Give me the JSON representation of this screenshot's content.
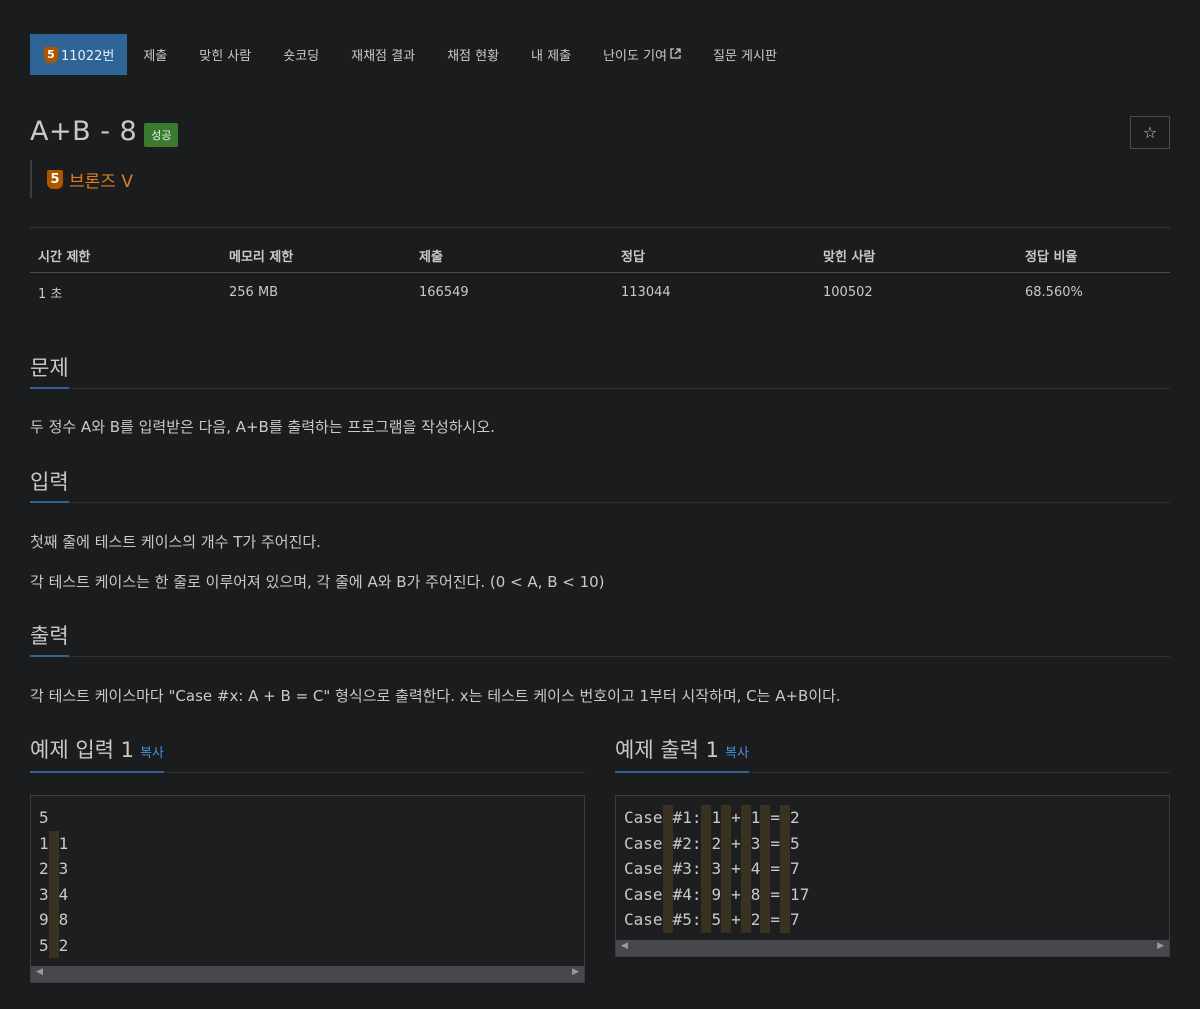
{
  "nav": {
    "problem_tier": "5",
    "problem_number": "11022번",
    "items": [
      "제출",
      "맞힌 사람",
      "숏코딩",
      "재채점 결과",
      "채점 현황",
      "내 제출",
      "난이도 기여",
      "질문 게시판"
    ]
  },
  "title": "A+B - 8",
  "status": "성공",
  "star_icon": "☆",
  "tier": {
    "number": "5",
    "name": "브론즈 V",
    "color": "#ad5600"
  },
  "stats": {
    "headers": [
      "시간 제한",
      "메모리 제한",
      "제출",
      "정답",
      "맞힌 사람",
      "정답 비율"
    ],
    "values": [
      "1 초",
      "256 MB",
      "166549",
      "113044",
      "100502",
      "68.560%"
    ]
  },
  "sections": {
    "problem": {
      "title": "문제",
      "text": "두 정수 A와 B를 입력받은 다음, A+B를 출력하는 프로그램을 작성하시오."
    },
    "input": {
      "title": "입력",
      "lines": [
        "첫째 줄에 테스트 케이스의 개수 T가 주어진다.",
        "각 테스트 케이스는 한 줄로 이루어져 있으며, 각 줄에 A와 B가 주어진다. (0 < A, B < 10)"
      ]
    },
    "output": {
      "title": "출력",
      "text": "각 테스트 케이스마다 \"Case #x: A + B = C\" 형식으로 출력한다. x는 테스트 케이스 번호이고 1부터 시작하며, C는 A+B이다."
    }
  },
  "samples": {
    "input": {
      "title": "예제 입력 1",
      "copy": "복사",
      "lines": [
        "5",
        "1 1",
        "2 3",
        "3 4",
        "9 8",
        "5 2"
      ]
    },
    "output": {
      "title": "예제 출력 1",
      "copy": "복사",
      "lines": [
        "Case #1: 1 + 1 = 2",
        "Case #2: 2 + 3 = 5",
        "Case #3: 3 + 4 = 7",
        "Case #4: 9 + 8 = 17",
        "Case #5: 5 + 2 = 7"
      ]
    }
  },
  "colors": {
    "background": "#1b1c1e",
    "nav_active": "#2f6497",
    "success": "#3c7a30",
    "bronze": "#e27d1f",
    "link": "#4a91d8"
  }
}
